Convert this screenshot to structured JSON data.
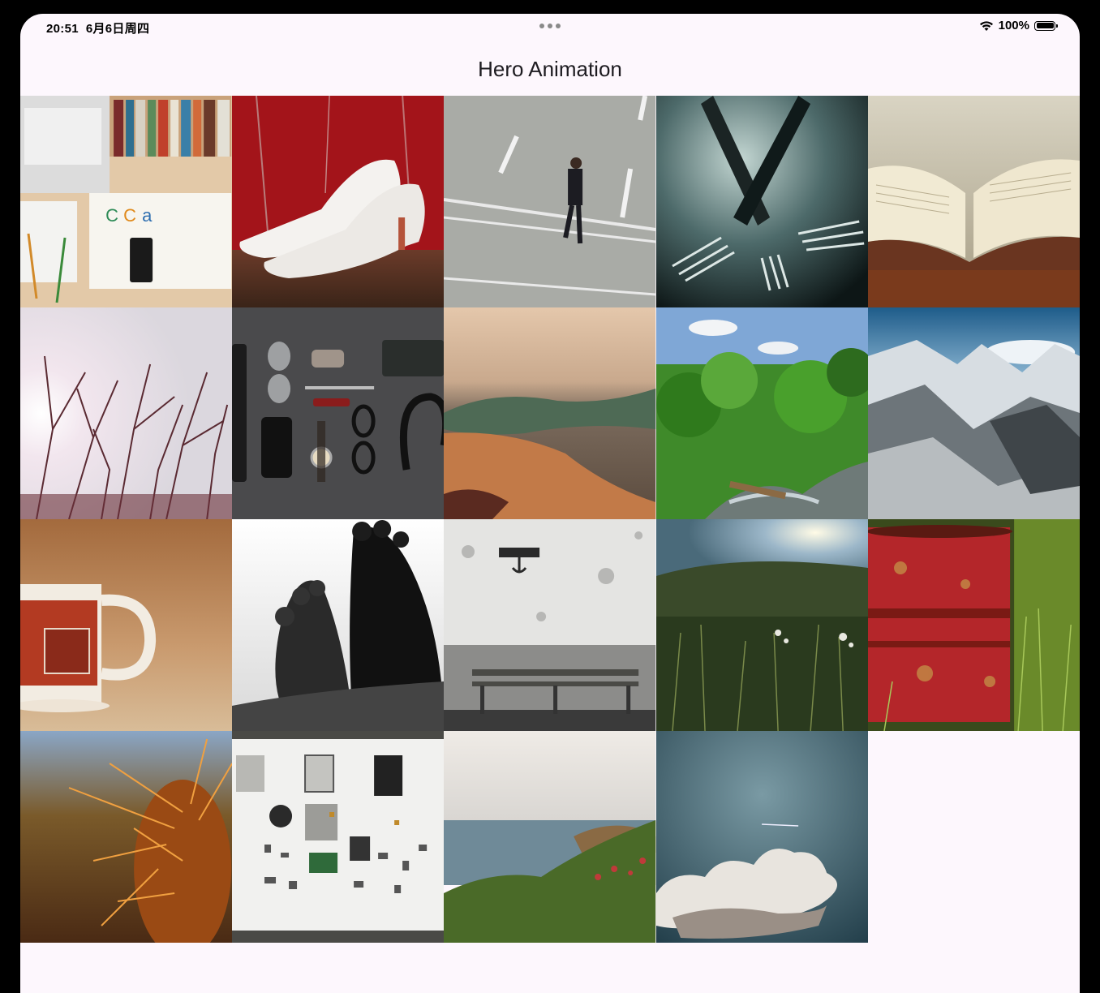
{
  "status_bar": {
    "time": "20:51",
    "date": "6月6日周四",
    "battery": "100%"
  },
  "app_bar": {
    "title": "Hero Animation"
  },
  "photos": [
    {
      "name": "workspace-books-photo"
    },
    {
      "name": "white-heels-photo"
    },
    {
      "name": "man-walking-road-photo"
    },
    {
      "name": "forks-photo"
    },
    {
      "name": "open-book-photo"
    },
    {
      "name": "branches-sunlight-photo"
    },
    {
      "name": "accessories-flatlay-photo"
    },
    {
      "name": "sea-wave-photo"
    },
    {
      "name": "green-valley-photo"
    },
    {
      "name": "snowy-mountains-photo"
    },
    {
      "name": "mug-photo"
    },
    {
      "name": "feet-bw-photo"
    },
    {
      "name": "bench-wall-photo"
    },
    {
      "name": "grass-meadow-photo"
    },
    {
      "name": "red-barrel-photo"
    },
    {
      "name": "cactus-photo"
    },
    {
      "name": "camera-parts-photo"
    },
    {
      "name": "coast-sea-photo"
    },
    {
      "name": "cloud-sky-photo"
    }
  ]
}
